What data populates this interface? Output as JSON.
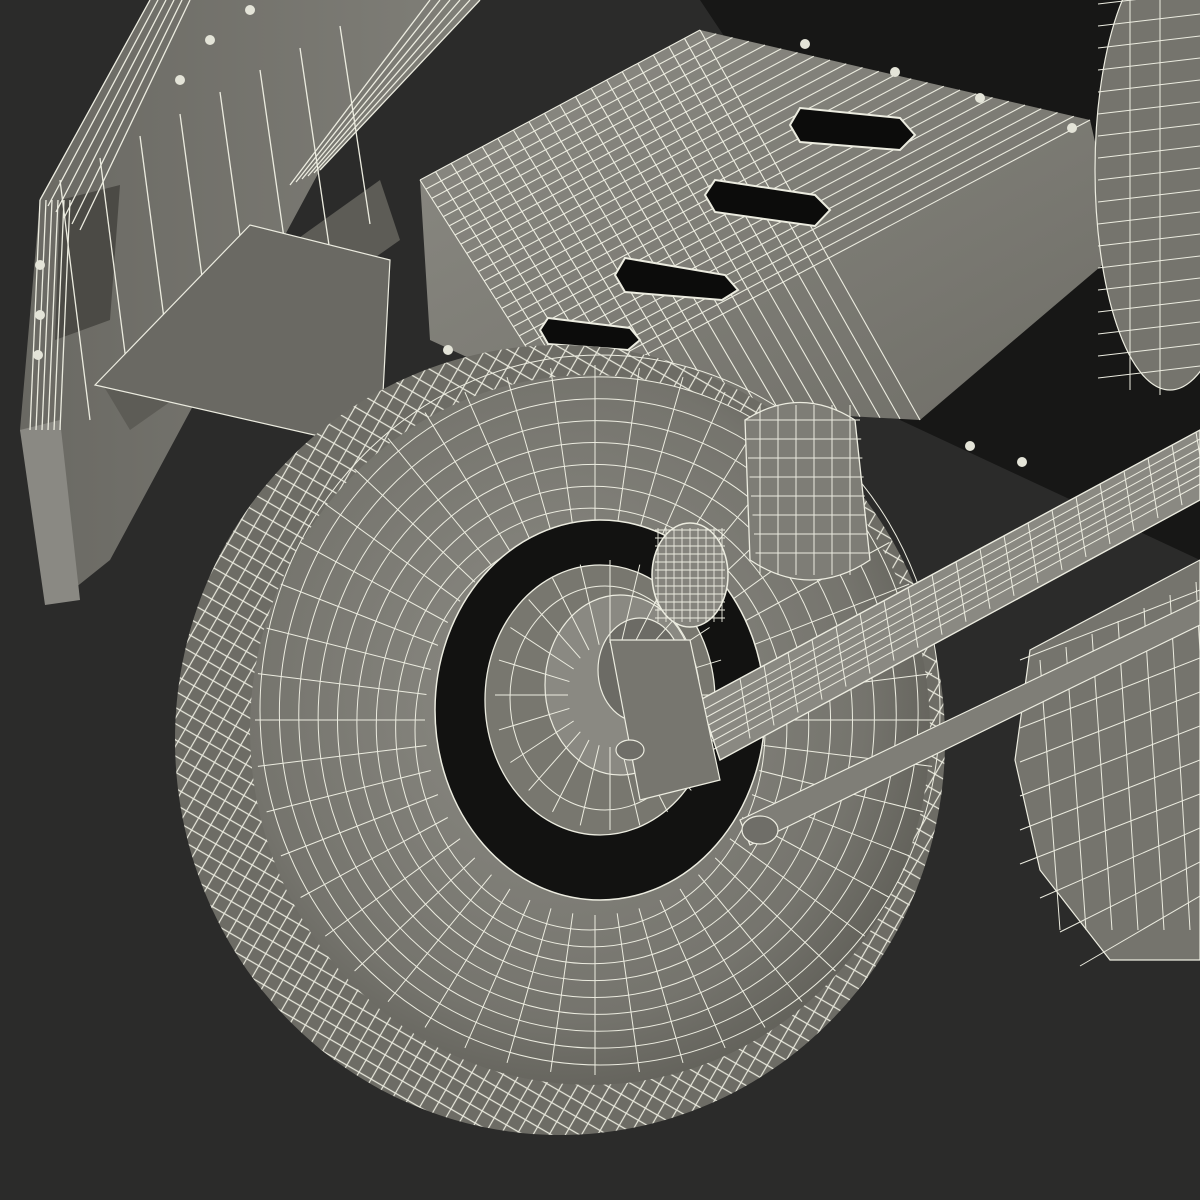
{
  "viewport": {
    "background": "#2b2b2a",
    "render_style": "wireframe-on-shaded",
    "surface_color": "#7e7d76",
    "wire_color": "#ecece0",
    "shadow_color": "#0e0e0d"
  },
  "model": {
    "visible_parts": [
      "rear-bumper",
      "chassis-bracket",
      "fuel-tank",
      "rear-tire",
      "wheel-rim",
      "bump-stop",
      "shock-absorber",
      "leaf-spring",
      "axle-rod",
      "second-tire",
      "bolts"
    ]
  }
}
